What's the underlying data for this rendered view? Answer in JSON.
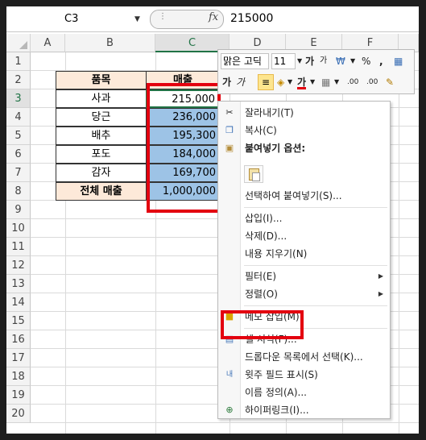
{
  "formula_bar": {
    "name_box": "C3",
    "fx_label": "fx",
    "fx_dots": "⋮",
    "value": "215000"
  },
  "columns": [
    "A",
    "B",
    "C",
    "D",
    "E",
    "F"
  ],
  "rows": [
    "1",
    "2",
    "3",
    "4",
    "5",
    "6",
    "7",
    "8",
    "9",
    "10",
    "11",
    "12",
    "13",
    "14",
    "15",
    "16",
    "17",
    "18",
    "19",
    "20"
  ],
  "table": {
    "header": [
      "품목",
      "매출"
    ],
    "rows": [
      {
        "item": "사과",
        "sales": "215,000"
      },
      {
        "item": "당근",
        "sales": "236,000"
      },
      {
        "item": "배추",
        "sales": "195,300"
      },
      {
        "item": "포도",
        "sales": "184,000"
      },
      {
        "item": "감자",
        "sales": "169,700"
      }
    ],
    "total": {
      "item": "전체 매출",
      "sales": "1,000,000"
    }
  },
  "mini_toolbar": {
    "font_name": "맑은 고딕",
    "font_size": "11",
    "increase_font": "가",
    "decrease_font": "가",
    "currency": "₩",
    "percent": "%",
    "comma": ",",
    "bold": "가",
    "italic": "가",
    "font_color_label": "가",
    "inc_decimal": ".00",
    "dec_decimal": ".00"
  },
  "context_menu": {
    "items": [
      {
        "label": "잘라내기(T)",
        "icon": "scissors-icon"
      },
      {
        "label": "복사(C)",
        "icon": "copy-icon"
      },
      {
        "label": "붙여넣기 옵션:",
        "icon": "paste-icon"
      },
      {
        "label": "선택하여 붙여넣기(S)..."
      },
      {
        "label": "삽입(I)..."
      },
      {
        "label": "삭제(D)..."
      },
      {
        "label": "내용 지우기(N)"
      },
      {
        "label": "필터(E)"
      },
      {
        "label": "정렬(O)"
      },
      {
        "label": "메모 삽입(M)",
        "icon": "note-icon"
      },
      {
        "label": "셀 서식(F)...",
        "icon": "format-cells-icon"
      },
      {
        "label": "드롭다운 목록에서 선택(K)..."
      },
      {
        "label": "윗주 필드 표시(S)",
        "icon": "phonetic-icon"
      },
      {
        "label": "이름 정의(A)..."
      },
      {
        "label": "하이퍼링크(I)...",
        "icon": "hyperlink-icon"
      }
    ],
    "submenu_arrow": "▶"
  },
  "colors": {
    "selection_green": "#217346",
    "highlight_red": "#e3000f",
    "selected_fill": "#9dc3e6",
    "header_fill": "#fdeada"
  }
}
